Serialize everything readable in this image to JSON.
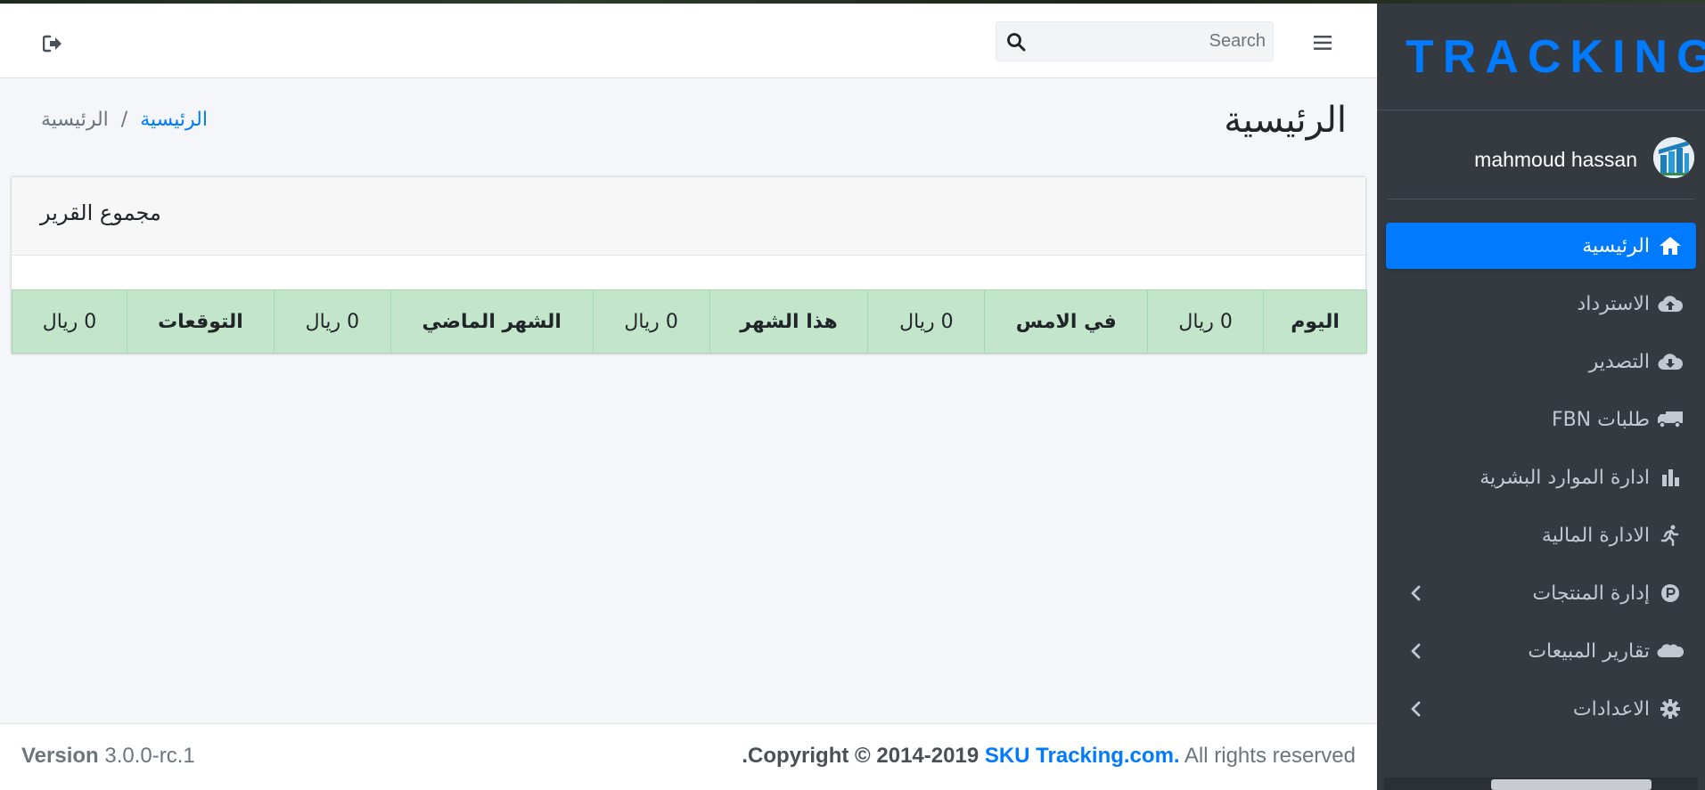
{
  "navbar": {
    "search_placeholder": "Search"
  },
  "page": {
    "title": "الرئيسية"
  },
  "breadcrumb": {
    "link": "الرئيسية",
    "separator": "/",
    "current": "الرئيسية"
  },
  "card": {
    "title": "مجموع القرير",
    "stats": [
      {
        "label": "اليوم",
        "value": "0 ريال"
      },
      {
        "label": "في الامس",
        "value": "0 ريال"
      },
      {
        "label": "هذا الشهر",
        "value": "0 ريال"
      },
      {
        "label": "الشهر الماضي",
        "value": "0 ريال"
      },
      {
        "label": "التوقعات",
        "value": "0 ريال"
      }
    ],
    "table_color": "#c3e6cb"
  },
  "footer": {
    "version_label": "Version",
    "version_value": "3.0.0-rc.1",
    "copyright_text": "Copyright © 2014-2019",
    "copyright_link": "SKU Tracking.com.",
    "rights": "All rights reserved",
    "leading_dot": "."
  },
  "sidebar": {
    "brand": "TRACKING",
    "brand_color": "#007bff",
    "user_name": "mahmoud hassan",
    "items": [
      {
        "label": "الرئيسية",
        "icon": "home-icon",
        "active": true
      },
      {
        "label": "الاسترداد",
        "icon": "cloud-upload-icon"
      },
      {
        "label": "التصدير",
        "icon": "cloud-download-icon"
      },
      {
        "label": "طلبات FBN",
        "icon": "truck-icon"
      },
      {
        "label": "ادارة الموارد البشرية",
        "icon": "bar-chart-icon"
      },
      {
        "label": "الادارة المالية",
        "icon": "running-icon"
      },
      {
        "label": "إدارة المنتجات",
        "icon": "parking-icon",
        "has_children": true
      },
      {
        "label": "تقارير المبيعات",
        "icon": "salesforce-icon",
        "has_children": true
      },
      {
        "label": "الاعدادات",
        "icon": "gear-icon",
        "has_children": true
      }
    ]
  }
}
